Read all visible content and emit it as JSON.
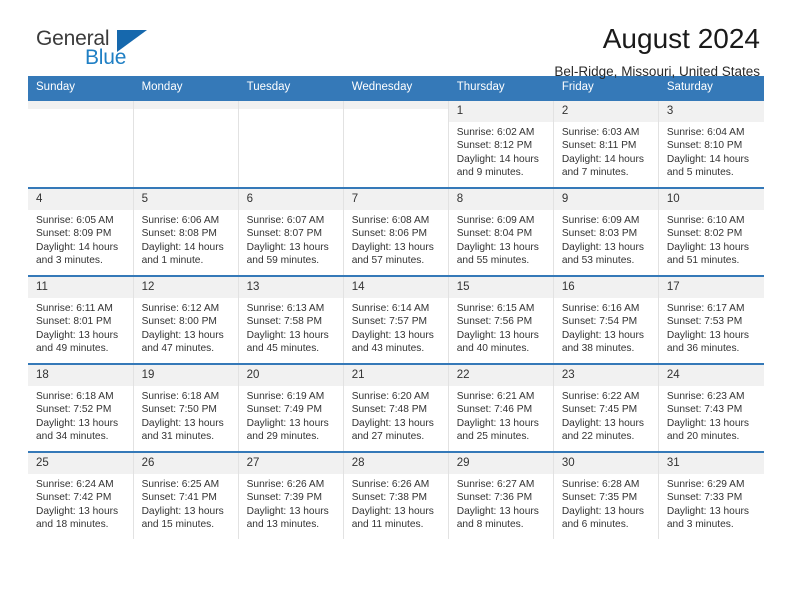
{
  "brand": {
    "name_top": "General",
    "name_bottom": "Blue",
    "accent_color": "#1668ad",
    "text_color": "#3b3b3b"
  },
  "header": {
    "title": "August 2024",
    "subtitle": "Bel-Ridge, Missouri, United States",
    "header_bg": "#3579b8",
    "daynum_bg": "#f1f1f1"
  },
  "weekday_headers": [
    "Sunday",
    "Monday",
    "Tuesday",
    "Wednesday",
    "Thursday",
    "Friday",
    "Saturday"
  ],
  "weeks": [
    [
      {
        "day": "",
        "sunrise": "",
        "sunset": "",
        "daylight": "",
        "empty": true
      },
      {
        "day": "",
        "sunrise": "",
        "sunset": "",
        "daylight": "",
        "empty": true
      },
      {
        "day": "",
        "sunrise": "",
        "sunset": "",
        "daylight": "",
        "empty": true
      },
      {
        "day": "",
        "sunrise": "",
        "sunset": "",
        "daylight": "",
        "empty": true
      },
      {
        "day": "1",
        "sunrise": "Sunrise: 6:02 AM",
        "sunset": "Sunset: 8:12 PM",
        "daylight": "Daylight: 14 hours and 9 minutes.",
        "empty": false
      },
      {
        "day": "2",
        "sunrise": "Sunrise: 6:03 AM",
        "sunset": "Sunset: 8:11 PM",
        "daylight": "Daylight: 14 hours and 7 minutes.",
        "empty": false
      },
      {
        "day": "3",
        "sunrise": "Sunrise: 6:04 AM",
        "sunset": "Sunset: 8:10 PM",
        "daylight": "Daylight: 14 hours and 5 minutes.",
        "empty": false
      }
    ],
    [
      {
        "day": "4",
        "sunrise": "Sunrise: 6:05 AM",
        "sunset": "Sunset: 8:09 PM",
        "daylight": "Daylight: 14 hours and 3 minutes.",
        "empty": false
      },
      {
        "day": "5",
        "sunrise": "Sunrise: 6:06 AM",
        "sunset": "Sunset: 8:08 PM",
        "daylight": "Daylight: 14 hours and 1 minute.",
        "empty": false
      },
      {
        "day": "6",
        "sunrise": "Sunrise: 6:07 AM",
        "sunset": "Sunset: 8:07 PM",
        "daylight": "Daylight: 13 hours and 59 minutes.",
        "empty": false
      },
      {
        "day": "7",
        "sunrise": "Sunrise: 6:08 AM",
        "sunset": "Sunset: 8:06 PM",
        "daylight": "Daylight: 13 hours and 57 minutes.",
        "empty": false
      },
      {
        "day": "8",
        "sunrise": "Sunrise: 6:09 AM",
        "sunset": "Sunset: 8:04 PM",
        "daylight": "Daylight: 13 hours and 55 minutes.",
        "empty": false
      },
      {
        "day": "9",
        "sunrise": "Sunrise: 6:09 AM",
        "sunset": "Sunset: 8:03 PM",
        "daylight": "Daylight: 13 hours and 53 minutes.",
        "empty": false
      },
      {
        "day": "10",
        "sunrise": "Sunrise: 6:10 AM",
        "sunset": "Sunset: 8:02 PM",
        "daylight": "Daylight: 13 hours and 51 minutes.",
        "empty": false
      }
    ],
    [
      {
        "day": "11",
        "sunrise": "Sunrise: 6:11 AM",
        "sunset": "Sunset: 8:01 PM",
        "daylight": "Daylight: 13 hours and 49 minutes.",
        "empty": false
      },
      {
        "day": "12",
        "sunrise": "Sunrise: 6:12 AM",
        "sunset": "Sunset: 8:00 PM",
        "daylight": "Daylight: 13 hours and 47 minutes.",
        "empty": false
      },
      {
        "day": "13",
        "sunrise": "Sunrise: 6:13 AM",
        "sunset": "Sunset: 7:58 PM",
        "daylight": "Daylight: 13 hours and 45 minutes.",
        "empty": false
      },
      {
        "day": "14",
        "sunrise": "Sunrise: 6:14 AM",
        "sunset": "Sunset: 7:57 PM",
        "daylight": "Daylight: 13 hours and 43 minutes.",
        "empty": false
      },
      {
        "day": "15",
        "sunrise": "Sunrise: 6:15 AM",
        "sunset": "Sunset: 7:56 PM",
        "daylight": "Daylight: 13 hours and 40 minutes.",
        "empty": false
      },
      {
        "day": "16",
        "sunrise": "Sunrise: 6:16 AM",
        "sunset": "Sunset: 7:54 PM",
        "daylight": "Daylight: 13 hours and 38 minutes.",
        "empty": false
      },
      {
        "day": "17",
        "sunrise": "Sunrise: 6:17 AM",
        "sunset": "Sunset: 7:53 PM",
        "daylight": "Daylight: 13 hours and 36 minutes.",
        "empty": false
      }
    ],
    [
      {
        "day": "18",
        "sunrise": "Sunrise: 6:18 AM",
        "sunset": "Sunset: 7:52 PM",
        "daylight": "Daylight: 13 hours and 34 minutes.",
        "empty": false
      },
      {
        "day": "19",
        "sunrise": "Sunrise: 6:18 AM",
        "sunset": "Sunset: 7:50 PM",
        "daylight": "Daylight: 13 hours and 31 minutes.",
        "empty": false
      },
      {
        "day": "20",
        "sunrise": "Sunrise: 6:19 AM",
        "sunset": "Sunset: 7:49 PM",
        "daylight": "Daylight: 13 hours and 29 minutes.",
        "empty": false
      },
      {
        "day": "21",
        "sunrise": "Sunrise: 6:20 AM",
        "sunset": "Sunset: 7:48 PM",
        "daylight": "Daylight: 13 hours and 27 minutes.",
        "empty": false
      },
      {
        "day": "22",
        "sunrise": "Sunrise: 6:21 AM",
        "sunset": "Sunset: 7:46 PM",
        "daylight": "Daylight: 13 hours and 25 minutes.",
        "empty": false
      },
      {
        "day": "23",
        "sunrise": "Sunrise: 6:22 AM",
        "sunset": "Sunset: 7:45 PM",
        "daylight": "Daylight: 13 hours and 22 minutes.",
        "empty": false
      },
      {
        "day": "24",
        "sunrise": "Sunrise: 6:23 AM",
        "sunset": "Sunset: 7:43 PM",
        "daylight": "Daylight: 13 hours and 20 minutes.",
        "empty": false
      }
    ],
    [
      {
        "day": "25",
        "sunrise": "Sunrise: 6:24 AM",
        "sunset": "Sunset: 7:42 PM",
        "daylight": "Daylight: 13 hours and 18 minutes.",
        "empty": false
      },
      {
        "day": "26",
        "sunrise": "Sunrise: 6:25 AM",
        "sunset": "Sunset: 7:41 PM",
        "daylight": "Daylight: 13 hours and 15 minutes.",
        "empty": false
      },
      {
        "day": "27",
        "sunrise": "Sunrise: 6:26 AM",
        "sunset": "Sunset: 7:39 PM",
        "daylight": "Daylight: 13 hours and 13 minutes.",
        "empty": false
      },
      {
        "day": "28",
        "sunrise": "Sunrise: 6:26 AM",
        "sunset": "Sunset: 7:38 PM",
        "daylight": "Daylight: 13 hours and 11 minutes.",
        "empty": false
      },
      {
        "day": "29",
        "sunrise": "Sunrise: 6:27 AM",
        "sunset": "Sunset: 7:36 PM",
        "daylight": "Daylight: 13 hours and 8 minutes.",
        "empty": false
      },
      {
        "day": "30",
        "sunrise": "Sunrise: 6:28 AM",
        "sunset": "Sunset: 7:35 PM",
        "daylight": "Daylight: 13 hours and 6 minutes.",
        "empty": false
      },
      {
        "day": "31",
        "sunrise": "Sunrise: 6:29 AM",
        "sunset": "Sunset: 7:33 PM",
        "daylight": "Daylight: 13 hours and 3 minutes.",
        "empty": false
      }
    ]
  ]
}
